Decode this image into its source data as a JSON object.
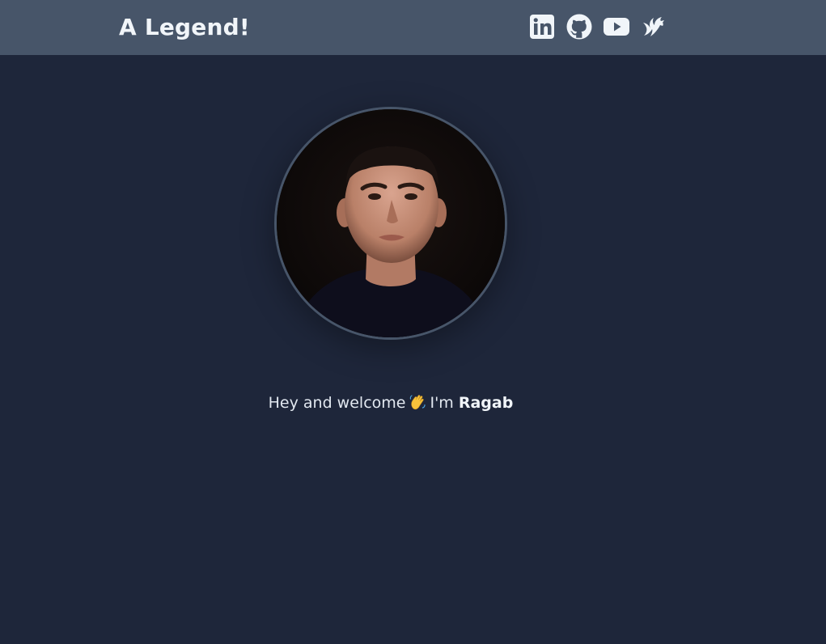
{
  "header": {
    "title": "A Legend!",
    "social": [
      {
        "name": "linkedin-icon",
        "label": "LinkedIn"
      },
      {
        "name": "github-icon",
        "label": "GitHub"
      },
      {
        "name": "youtube-icon",
        "label": "YouTube"
      },
      {
        "name": "hashnode-icon",
        "label": "Blog"
      }
    ]
  },
  "profile": {
    "avatar_alt": "Profile photo of Ragab"
  },
  "greeting": {
    "prefix": "Hey and welcome",
    "emoji": "waving-hand-icon",
    "middle": "I'm",
    "name": "Ragab"
  },
  "colors": {
    "background": "#1e263a",
    "header": "#475569",
    "text": "#e2e8f0",
    "avatar_border": "#475569"
  }
}
